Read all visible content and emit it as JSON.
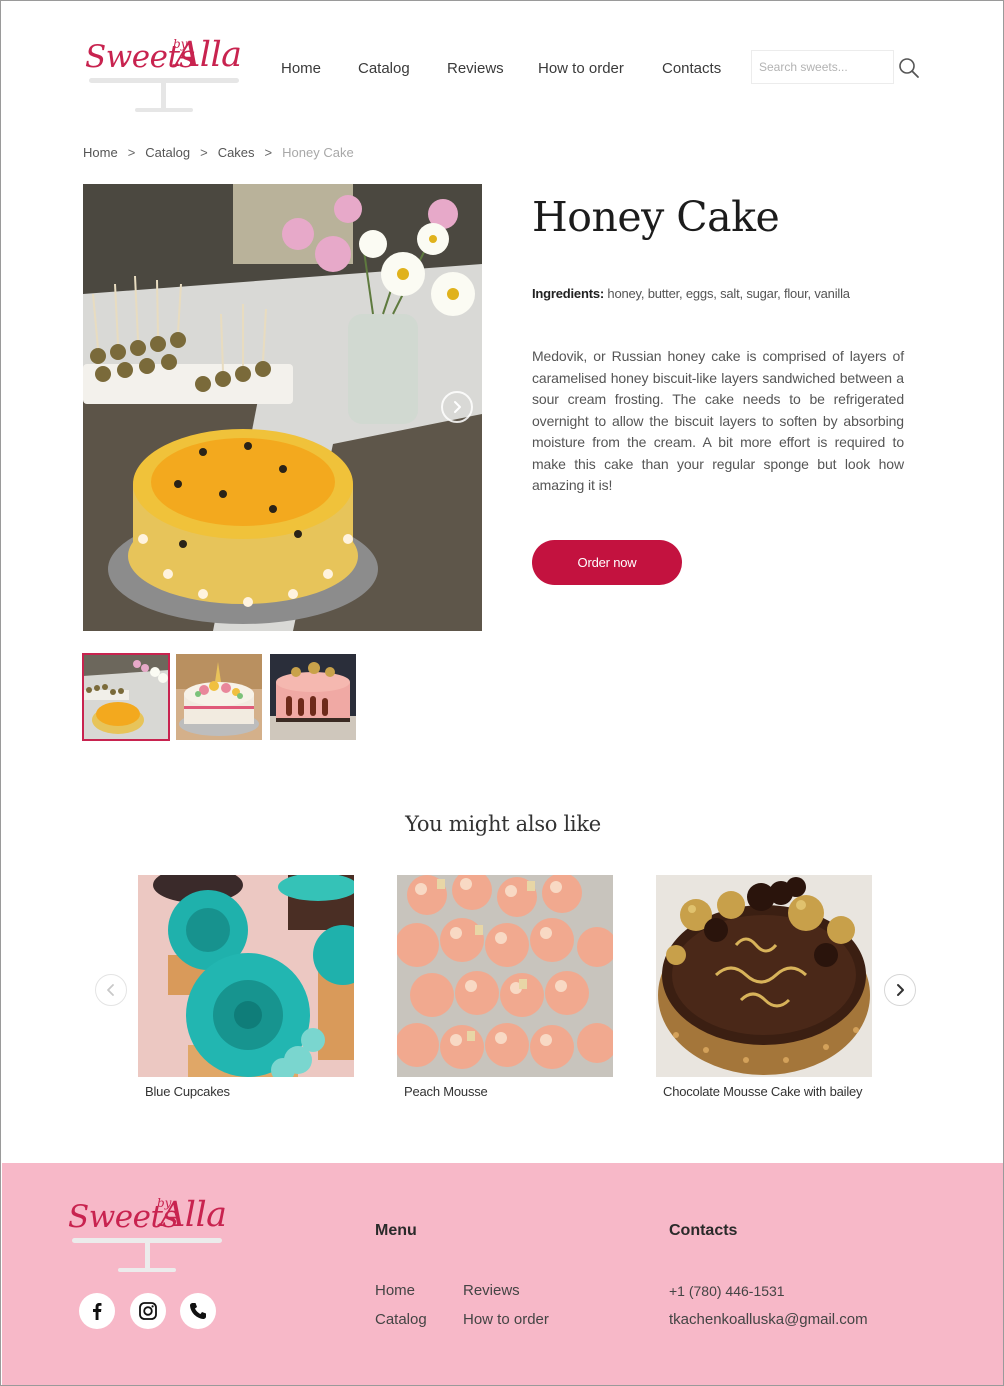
{
  "brand": {
    "logo_text": "Sweets",
    "logo_by": "by",
    "logo_name": "Alla"
  },
  "nav": {
    "items": [
      {
        "label": "Home"
      },
      {
        "label": "Catalog"
      },
      {
        "label": "Reviews"
      },
      {
        "label": "How to order"
      },
      {
        "label": "Contacts"
      }
    ]
  },
  "search": {
    "placeholder": "Search sweets...",
    "icon": "search-icon"
  },
  "breadcrumb": {
    "items": [
      {
        "label": "Home"
      },
      {
        "label": "Catalog"
      },
      {
        "label": "Cakes"
      },
      {
        "label": "Honey Cake"
      }
    ],
    "separator": ">"
  },
  "product": {
    "title": "Honey Cake",
    "ingredients_label": "Ingredients:",
    "ingredients": "honey, butter, eggs, salt, sugar, flour, vanilla",
    "description": "Medovik, or Russian honey cake is comprised of layers of caramelised honey biscuit-like layers sandwiched between a sour cream frosting. The cake needs to be refrigerated overnight to allow the biscuit layers to soften by absorbing moisture from the cream. A bit more effort is required to make this cake than your regular sponge but look how amazing it is!",
    "order_label": "Order now",
    "thumbnail_count": 3,
    "active_thumbnail": 1
  },
  "related": {
    "title": "You might also like",
    "items": [
      {
        "name": "Blue Cupcakes"
      },
      {
        "name": "Peach Mousse"
      },
      {
        "name": "Chocolate Mousse Cake with bailey"
      }
    ]
  },
  "footer": {
    "menu_title": "Menu",
    "menu_items": [
      {
        "label": "Home"
      },
      {
        "label": "Reviews"
      },
      {
        "label": "Catalog"
      },
      {
        "label": "How to order"
      }
    ],
    "contacts_title": "Contacts",
    "phone": "+1 (780) 446-1531",
    "email": "tkachenkoalluska@gmail.com",
    "social": [
      "facebook-icon",
      "instagram-icon",
      "phone-icon"
    ]
  },
  "colors": {
    "accent": "#c3123f",
    "logo": "#c8234f",
    "footer_bg": "#f7b8c8"
  }
}
